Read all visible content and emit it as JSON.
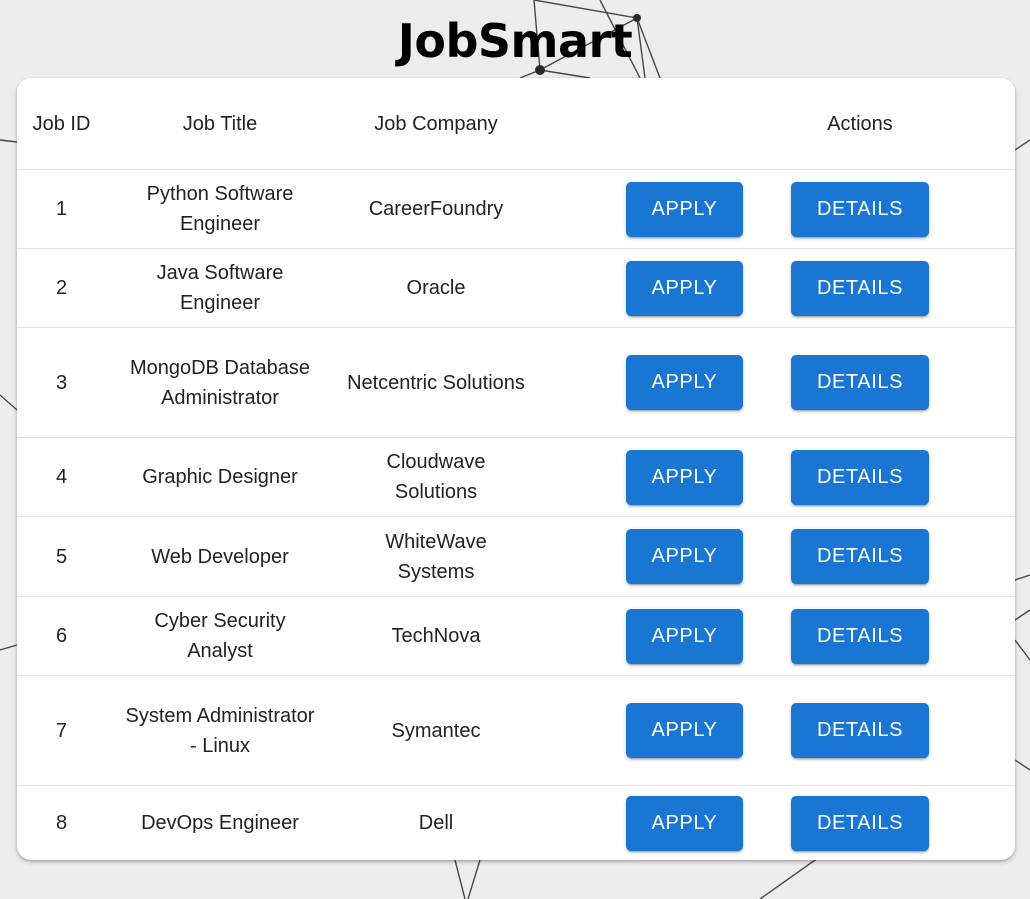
{
  "app": {
    "title": "JobSmart"
  },
  "table": {
    "headers": {
      "id": "Job ID",
      "title": "Job Title",
      "company": "Job Company",
      "actions": "Actions"
    },
    "apply_label": "APPLY",
    "details_label": "DETAILS",
    "rows": [
      {
        "id": "1",
        "title": "Python Software Engineer",
        "company": "CareerFoundry"
      },
      {
        "id": "2",
        "title": "Java Software Engineer",
        "company": "Oracle"
      },
      {
        "id": "3",
        "title": "MongoDB Database Administrator",
        "company": "Netcentric Solutions"
      },
      {
        "id": "4",
        "title": "Graphic Designer",
        "company": "Cloudwave Solutions"
      },
      {
        "id": "5",
        "title": "Web Developer",
        "company": "WhiteWave Systems"
      },
      {
        "id": "6",
        "title": "Cyber Security Analyst",
        "company": "TechNova"
      },
      {
        "id": "7",
        "title": "System Administrator - Linux",
        "company": "Symantec"
      },
      {
        "id": "8",
        "title": "DevOps Engineer",
        "company": "Dell"
      }
    ]
  },
  "colors": {
    "button": "#1976d2",
    "background": "#ededed",
    "network_lines": "#2b2b2b"
  }
}
